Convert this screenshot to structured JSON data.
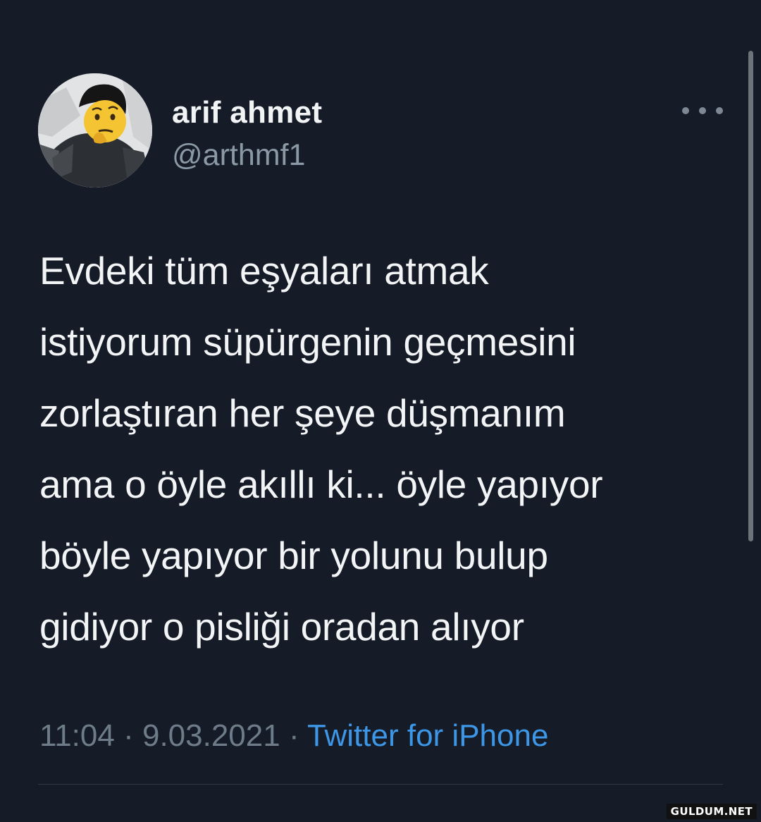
{
  "tweet": {
    "author": {
      "display_name": "arif ahmet",
      "handle": "@arthmf1",
      "avatar_icon": "user-avatar-with-thinking-emoji"
    },
    "more_icon": "more-horizontal-icon",
    "text_lines": [
      "Evdeki tüm eşyaları atmak",
      "istiyorum süpürgenin geçmesini",
      "zorlaştıran her şeye düşmanım",
      "ama o öyle akıllı ki... öyle yapıyor",
      "böyle yapıyor bir yolunu bulup",
      "gidiyor o pisliği oradan alıyor"
    ],
    "time": "11:04",
    "separator": "·",
    "date": "9.03.2021",
    "source": "Twitter for iPhone"
  },
  "watermark": "GULDUM.NET",
  "colors": {
    "background": "#151c28",
    "text": "#f2f4f5",
    "muted": "#8b98a5",
    "link": "#3d96e6"
  }
}
